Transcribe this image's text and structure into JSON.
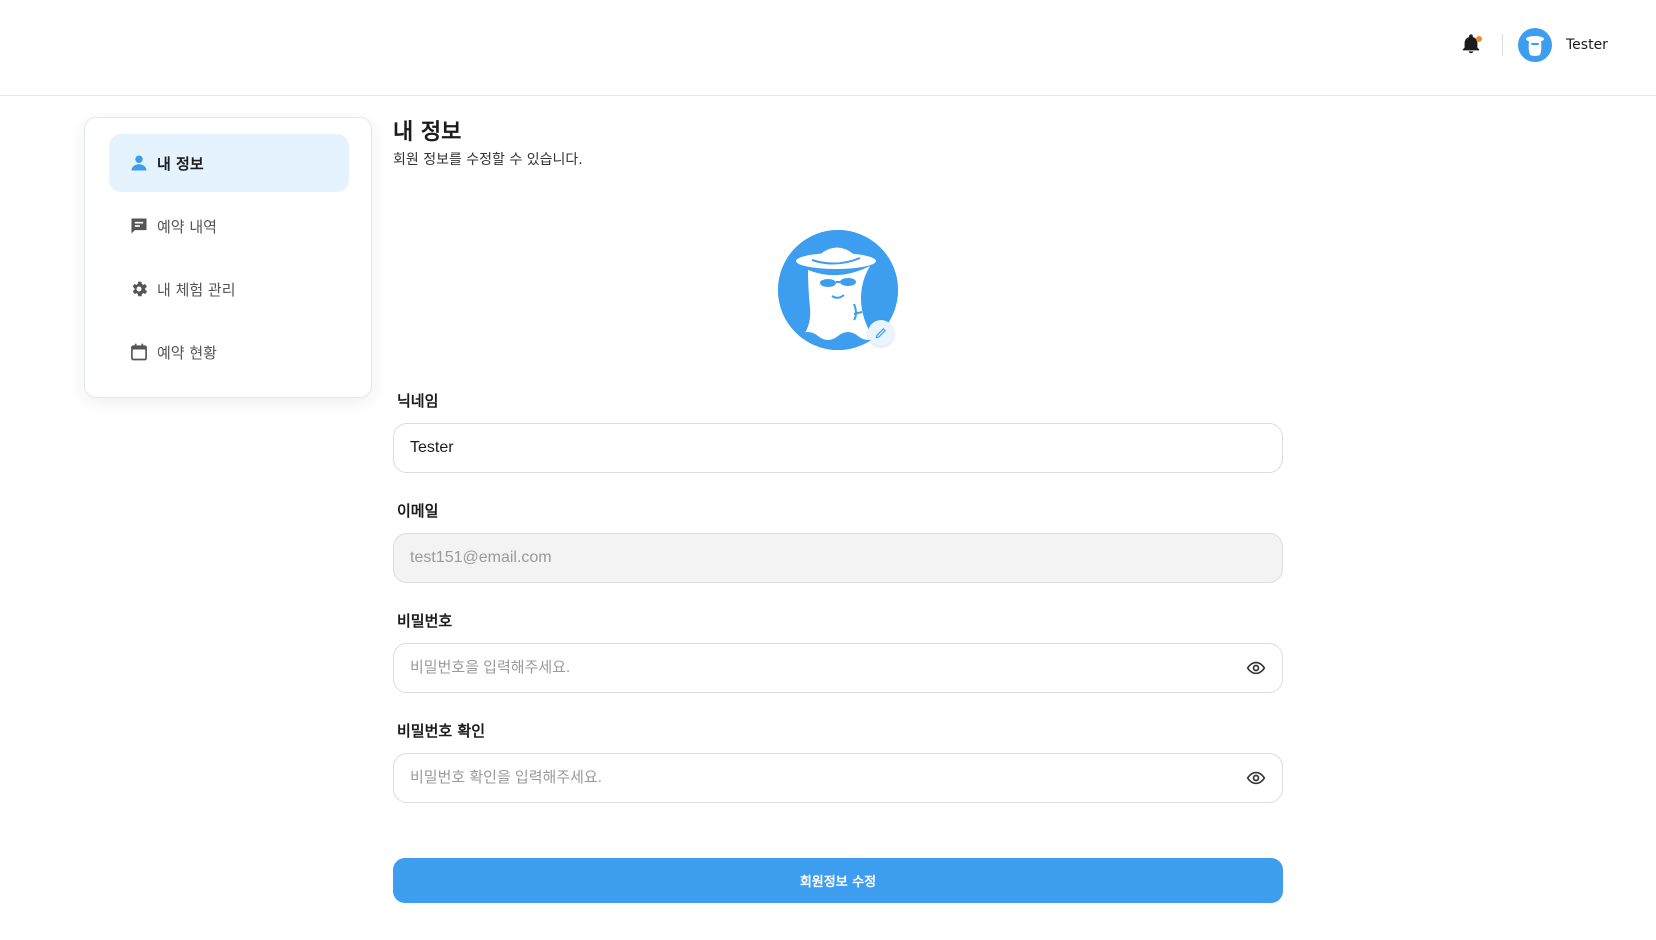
{
  "header": {
    "user_name": "Tester"
  },
  "sidebar": {
    "items": [
      {
        "label": "내 정보",
        "icon": "user-icon",
        "active": true
      },
      {
        "label": "예약 내역",
        "icon": "message-icon",
        "active": false
      },
      {
        "label": "내 체험 관리",
        "icon": "gear-icon",
        "active": false
      },
      {
        "label": "예약 현황",
        "icon": "calendar-icon",
        "active": false
      }
    ]
  },
  "main": {
    "title": "내 정보",
    "subtitle": "회원 정보를 수정할 수 있습니다.",
    "nickname": {
      "label": "닉네임",
      "value": "Tester"
    },
    "email": {
      "label": "이메일",
      "value": "test151@email.com"
    },
    "password": {
      "label": "비밀번호",
      "placeholder": "비밀번호을 입력해주세요."
    },
    "password_confirm": {
      "label": "비밀번호 확인",
      "placeholder": "비밀번호 확인을 입력해주세요."
    },
    "submit_label": "회원정보 수정"
  },
  "colors": {
    "accent": "#3d9ef0",
    "active_bg": "#e5f3ff",
    "notification_dot": "#f08c2e"
  }
}
